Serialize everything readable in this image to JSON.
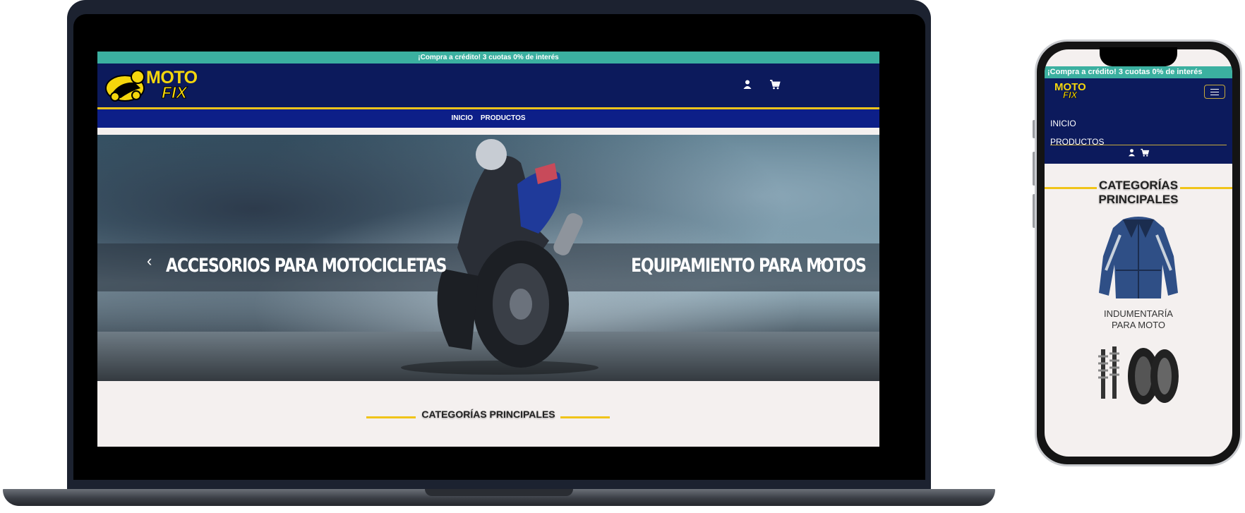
{
  "promo_bar": {
    "text": "¡Compra a crédito! 3 cuotas 0% de interés"
  },
  "brand": {
    "line1": "MOTO",
    "line2": "FIX"
  },
  "nav": {
    "items": [
      {
        "label": "INICIO"
      },
      {
        "label": "PRODUCTOS"
      }
    ]
  },
  "header_icons": {
    "user": "user-icon",
    "cart": "cart-icon",
    "menu": "hamburger-menu-icon"
  },
  "hero": {
    "left_caption": "ACCESORIOS PARA MOTOCICLETAS",
    "right_caption": "EQUIPAMIENTO PARA MOTOS",
    "prev": "‹",
    "next": "›"
  },
  "categories": {
    "title": "CATEGORÍAS PRINCIPALES",
    "title_mobile_line1": "CATEGORÍAS",
    "title_mobile_line2": "PRINCIPALES",
    "items": [
      {
        "label_line1": "INDUMENTARÍA",
        "label_line2": "PARA MOTO"
      }
    ]
  },
  "colors": {
    "promo": "#3bb0a0",
    "header": "#0c1a5c",
    "nav": "#0d1f88",
    "accent_yellow": "#f0c419",
    "logo_yellow": "#f5d60c",
    "page_bg": "#f4f0ef"
  }
}
